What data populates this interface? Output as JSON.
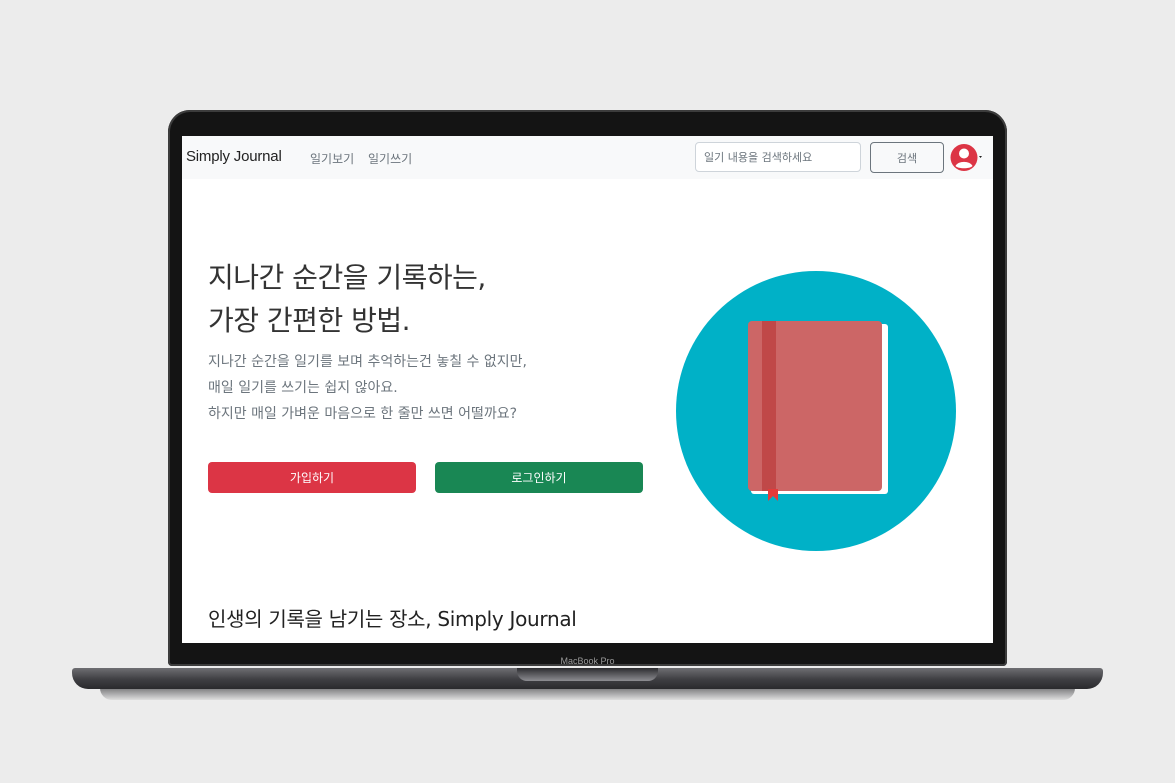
{
  "device": {
    "label": "MacBook Pro"
  },
  "navbar": {
    "brand": "Simply Journal",
    "links": [
      "일기보기",
      "일기쓰기"
    ],
    "search_placeholder": "일기 내용을 검색하세요",
    "search_button": "검색",
    "avatar_icon": "user-circle-icon",
    "avatar_color": "#dc3545"
  },
  "hero": {
    "headline_line1": "지나간 순간을 기록하는,",
    "headline_line2": "가장 간편한 방법.",
    "description_lines": [
      "지나간 순간을 일기를 보며 추억하는건 놓칠 수 없지만,",
      "매일 일기를 쓰기는 쉽지 않아요.",
      "하지만 매일 가벼운 마음으로 한 줄만 쓰면 어떨까요?"
    ],
    "signup_button": "가입하기",
    "login_button": "로그인하기",
    "signup_color": "#dc3545",
    "login_color": "#198754",
    "illustration_icon": "journal-book-icon",
    "circle_color": "#00b1c7",
    "book_color": "#cc6666"
  },
  "section": {
    "heading": "인생의 기록을 남기는 장소, Simply Journal"
  }
}
